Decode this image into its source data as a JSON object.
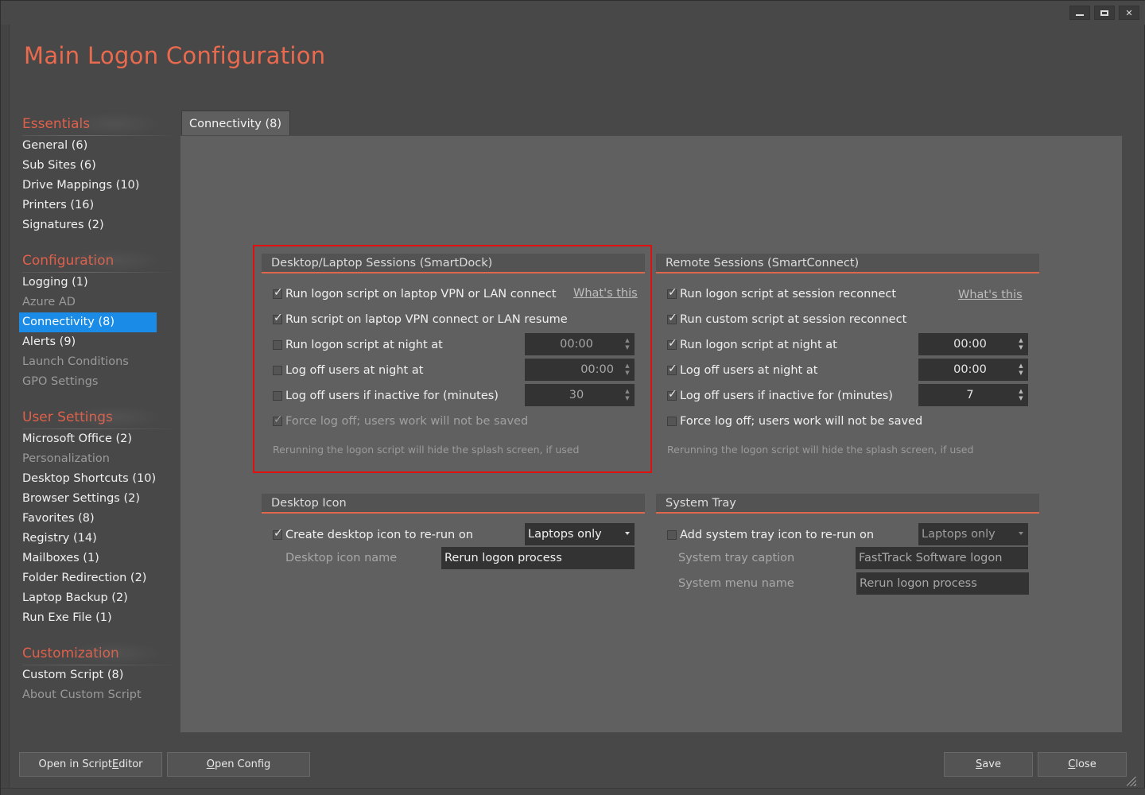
{
  "window": {
    "title": "Main Logon Configuration",
    "controls": {
      "minimize": "minimize",
      "maximize": "maximize",
      "close": "close"
    }
  },
  "sidebar": {
    "sections": [
      {
        "header": "Essentials",
        "items": [
          {
            "label": "General (6)",
            "state": "normal"
          },
          {
            "label": "Sub Sites (6)",
            "state": "normal"
          },
          {
            "label": "Drive Mappings (10)",
            "state": "normal"
          },
          {
            "label": "Printers (16)",
            "state": "normal"
          },
          {
            "label": "Signatures (2)",
            "state": "normal"
          }
        ]
      },
      {
        "header": "Configuration",
        "items": [
          {
            "label": "Logging (1)",
            "state": "normal"
          },
          {
            "label": "Azure AD",
            "state": "dim"
          },
          {
            "label": "Connectivity (8)",
            "state": "active"
          },
          {
            "label": "Alerts (9)",
            "state": "normal"
          },
          {
            "label": "Launch Conditions",
            "state": "dim"
          },
          {
            "label": "GPO Settings",
            "state": "dim"
          }
        ]
      },
      {
        "header": "User Settings",
        "items": [
          {
            "label": "Microsoft Office (2)",
            "state": "normal"
          },
          {
            "label": "Personalization",
            "state": "dim"
          },
          {
            "label": "Desktop Shortcuts (10)",
            "state": "normal"
          },
          {
            "label": "Browser Settings (2)",
            "state": "normal"
          },
          {
            "label": "Favorites (8)",
            "state": "normal"
          },
          {
            "label": "Registry (14)",
            "state": "normal"
          },
          {
            "label": "Mailboxes (1)",
            "state": "normal"
          },
          {
            "label": "Folder Redirection (2)",
            "state": "normal"
          },
          {
            "label": "Laptop Backup (2)",
            "state": "normal"
          },
          {
            "label": "Run Exe File (1)",
            "state": "normal"
          }
        ]
      },
      {
        "header": "Customization",
        "items": [
          {
            "label": "Custom Script (8)",
            "state": "normal"
          },
          {
            "label": "About Custom Script",
            "state": "dim"
          }
        ]
      }
    ]
  },
  "tab": {
    "label": "Connectivity (8)"
  },
  "desktop_sessions": {
    "title": "Desktop/Laptop Sessions (SmartDock)",
    "whats_this": "What's this",
    "options": [
      {
        "label": "Run logon script on laptop VPN or LAN connect",
        "checked": true
      },
      {
        "label": "Run script on laptop VPN connect or LAN resume",
        "checked": true
      },
      {
        "label": "Run logon script at night at",
        "checked": false,
        "value": "00:00"
      },
      {
        "label": "Log off users at night at",
        "checked": false,
        "value": "00:00"
      },
      {
        "label": "Log off users if inactive for (minutes)",
        "checked": false,
        "value": "30"
      },
      {
        "label": "Force log off; users work will not be saved",
        "checked": true,
        "disabled": true
      }
    ],
    "note": "Rerunning the logon script will hide the splash screen, if used"
  },
  "remote_sessions": {
    "title": "Remote Sessions (SmartConnect)",
    "whats_this": "What's this",
    "options": [
      {
        "label": "Run logon script at session reconnect",
        "checked": true
      },
      {
        "label": "Run custom script at session reconnect",
        "checked": true
      },
      {
        "label": "Run logon script at night at",
        "checked": true,
        "value": "00:00"
      },
      {
        "label": "Log off users at night at",
        "checked": true,
        "value": "00:00"
      },
      {
        "label": "Log off users if inactive for (minutes)",
        "checked": true,
        "value": "7"
      },
      {
        "label": "Force log off; users work will not be saved",
        "checked": false
      }
    ],
    "note": "Rerunning the logon script will hide the splash screen, if used"
  },
  "desktop_icon": {
    "title": "Desktop Icon",
    "create_label": "Create desktop icon to re-run on",
    "create_checked": true,
    "run_on_value": "Laptops only",
    "name_label": "Desktop icon name",
    "name_value": "Rerun logon process"
  },
  "system_tray": {
    "title": "System Tray",
    "add_label": "Add system tray icon to re-run on",
    "add_checked": false,
    "run_on_value": "Laptops only",
    "caption_label": "System tray caption",
    "caption_value": "FastTrack Software logon",
    "menu_label": "System menu name",
    "menu_value": "Rerun logon process"
  },
  "footer": {
    "open_script_editor": {
      "pre": "Open in Script ",
      "accel": "E",
      "post": "ditor"
    },
    "open_config": {
      "pre": "",
      "accel": "O",
      "post": "pen Config"
    },
    "save": {
      "pre": "",
      "accel": "S",
      "post": "ave"
    },
    "close": {
      "pre": "",
      "accel": "C",
      "post": "lose"
    }
  },
  "colors": {
    "accent": "#ea6a4e",
    "selection": "#1a8ce8",
    "highlight_border": "#e01010"
  }
}
